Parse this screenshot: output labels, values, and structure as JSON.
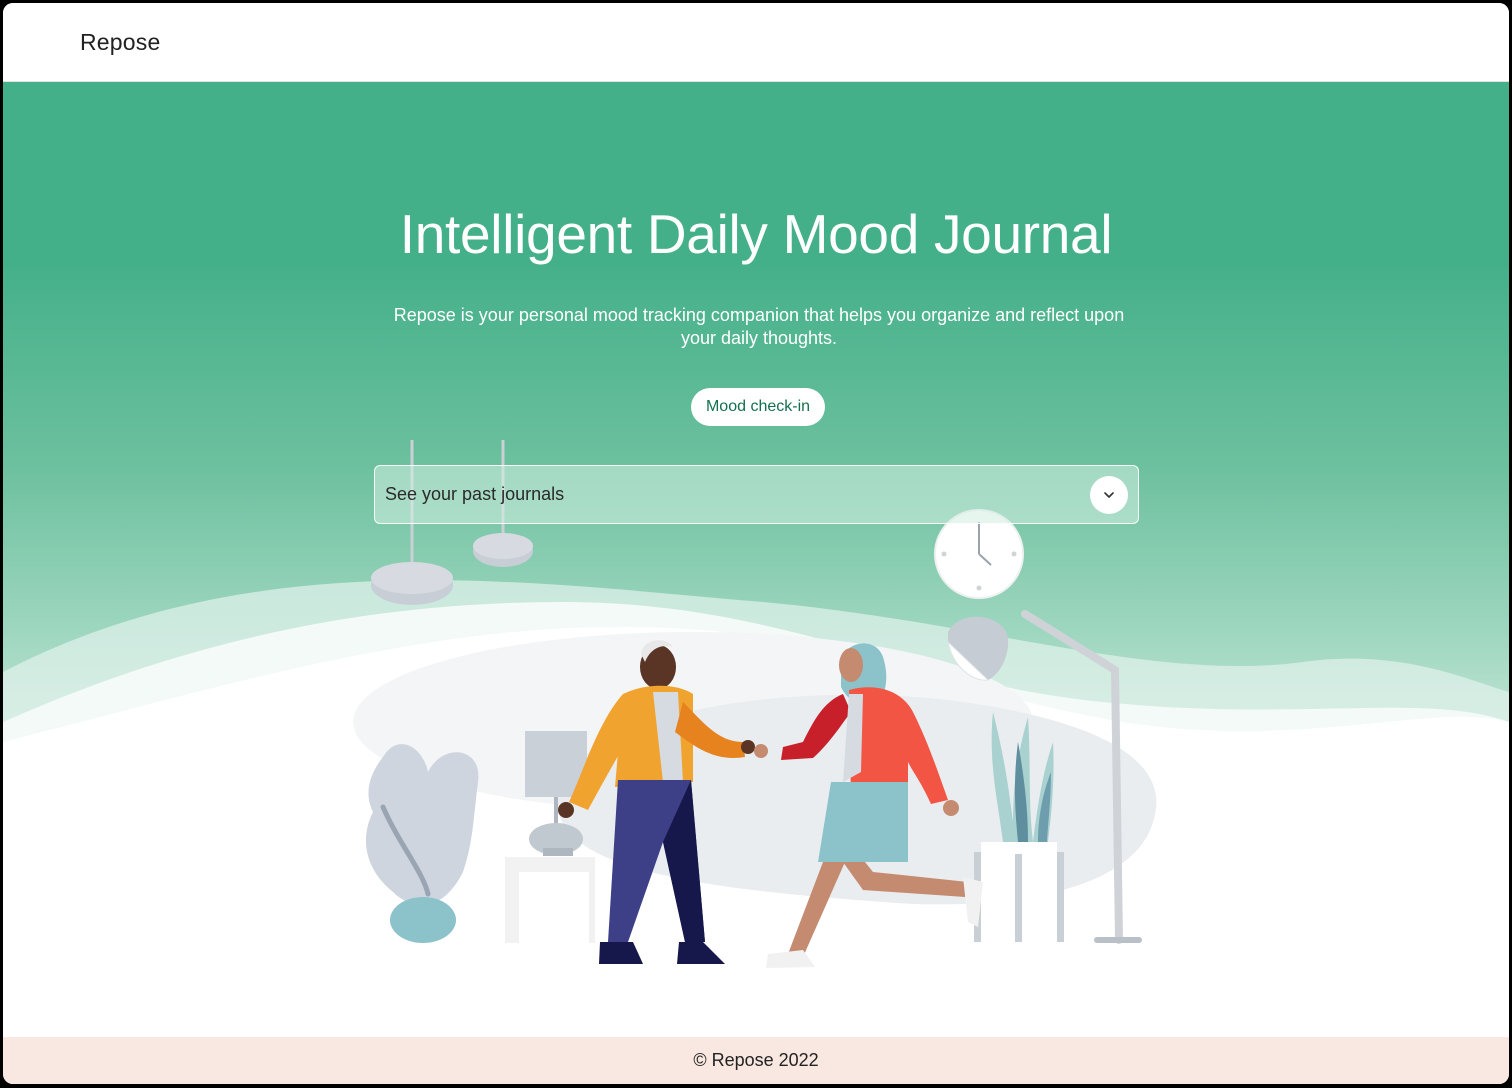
{
  "navbar": {
    "brand": "Repose"
  },
  "hero": {
    "title": "Intelligent Daily Mood Journal",
    "subtitle": "Repose is your personal mood tracking companion that helps you organize and reflect upon your daily thoughts.",
    "checkin_label": "Mood check-in"
  },
  "journals": {
    "label": "See your past journals",
    "toggle_icon": "chevron-down-icon"
  },
  "footer": {
    "copyright": "© Repose 2022"
  },
  "colors": {
    "hero_green": "#44b08a",
    "button_text": "#13704e",
    "footer_bg": "#f9e8e1"
  }
}
